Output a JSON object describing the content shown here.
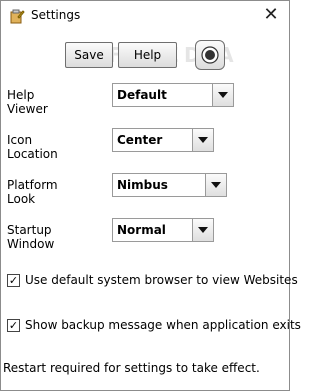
{
  "window": {
    "title": "Settings"
  },
  "toolbar": {
    "save_label": "Save",
    "help_label": "Help",
    "watermark_text": "SOFTPEDIA"
  },
  "fields": [
    {
      "label": "Help Viewer",
      "value": "Default"
    },
    {
      "label": "Icon Location",
      "value": "Center"
    },
    {
      "label": "Platform Look",
      "value": "Nimbus"
    },
    {
      "label": "Startup Window",
      "value": "Normal"
    }
  ],
  "options": [
    {
      "label": "Use default system browser to view Websites",
      "checked": true
    },
    {
      "label": "Show backup message when application exits",
      "checked": true
    }
  ],
  "footer": {
    "note": "Restart required for settings to take effect."
  }
}
